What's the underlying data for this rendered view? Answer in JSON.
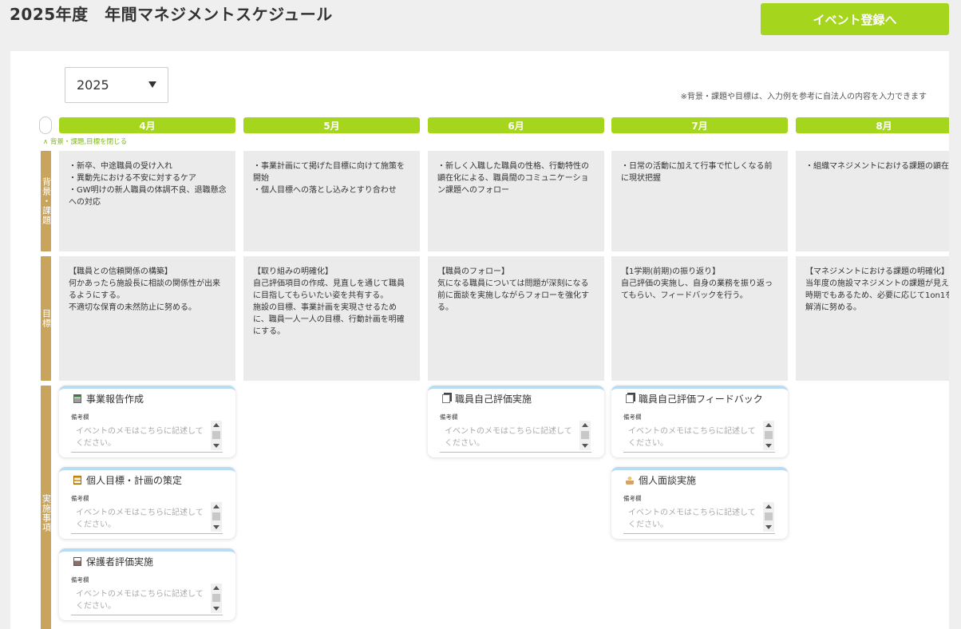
{
  "header": {
    "title": "2025年度　年間マネジメントスケジュール",
    "register_button": "イベント登録へ"
  },
  "year_select": {
    "value": "2025"
  },
  "note": "※背景・課題や目標は、入力例を参考に自法人の内容を入力できます",
  "collapse_link": "∧ 背景・課題,目標を閉じる",
  "row_labels": {
    "background": "背景・課題",
    "goals": "目標",
    "actions": "実施事項"
  },
  "months": [
    "4月",
    "5月",
    "6月",
    "7月",
    "8月"
  ],
  "background": [
    "・新卒、中途職員の受け入れ\n・異動先における不安に対するケア\n・GW明けの新人職員の体調不良、退職懸念への対応",
    "・事業計画にて掲げた目標に向けて施策を開始\n・個人目標への落とし込みとすり合わせ",
    "・新しく入職した職員の性格、行動特性の顕在化による、職員間のコミュニケーション課題へのフォロー",
    "・日常の活動に加えて行事で忙しくなる前に現状把握",
    "・組織マネジメントにおける課題の顕在化"
  ],
  "goals": [
    "【職員との信頼関係の構築】\n何かあったら施設長に相談の関係性が出来るようにする。\n不適切な保育の未然防止に努める。",
    "【取り組みの明確化】\n自己評価項目の作成、見直しを通じて職員に目指してもらいたい姿を共有する。\n施設の目標、事業計画を実現させるために、職員一人一人の目標、行動計画を明確にする。",
    "【職員のフォロー】\n気になる職員については問題が深刻になる前に面談を実施しながらフォローを強化する。",
    "【1学期(前期)の振り返り】\n自己評価の実施し、自身の業務を振り返ってもらい、フィードバックを行う。",
    "【マネジメントにおける課題の明確化】\n当年度の施設マネジメントの課題が見えてくる時期でもあるため、必要に応じて1on1を行い、解消に努める。"
  ],
  "events": {
    "memo_label": "備考欄",
    "memo_placeholder": "イベントのメモはこちらに記述してください。",
    "items": [
      {
        "title": "事業報告作成",
        "icon": "report-icon"
      },
      {
        "title": "個人目標・計画の策定",
        "icon": "list-icon"
      },
      {
        "title": "保護者評価実施",
        "icon": "box-icon"
      },
      {
        "title": "職員自己評価実施",
        "icon": "document-icon"
      },
      {
        "title": "職員自己評価フィードバック",
        "icon": "document-icon"
      },
      {
        "title": "個人面談実施",
        "icon": "person-icon"
      }
    ]
  }
}
